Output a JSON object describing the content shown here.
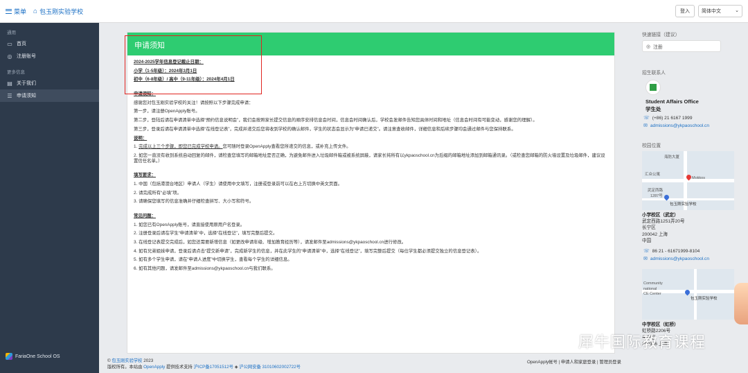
{
  "topbar": {
    "menu_label": "菜单",
    "school_name": "包玉刚实验学校",
    "login_label": "登入",
    "language": "简体中文"
  },
  "sidebar": {
    "section_general": "通用",
    "items_general": [
      {
        "label": "首页",
        "icon": "home-icon"
      },
      {
        "label": "注册账号",
        "icon": "compass-icon"
      }
    ],
    "section_more": "更多信息",
    "items_more": [
      {
        "label": "关于我们",
        "icon": "document-icon"
      },
      {
        "label": "申请须知",
        "icon": "list-icon"
      }
    ],
    "footer_brand": "FariaOne School OS"
  },
  "main": {
    "title": "申请须知",
    "deadline_title": "2024-2025学年信息登记截止日期：",
    "deadline_primary": "小学（1-5年级）：2024年3月1日",
    "deadline_secondary": "初中（6-8年级）/ 高中（9-11年级）：2024年4月1日",
    "notice_heading": "申请须知：",
    "intro": "感谢您对包玉刚实验学校的关注！请按照以下步骤完成申请：",
    "step1": "第一步，请注册OpenApply账号。",
    "step2": "第二步，登陆后请在申请清单中选择“预约信息说明会”，我们会按照家长提交信息的顺序安排信息会时间，信息会时间确认后，学校会发邮件告知您具体时间和地址（信息会时间有可能变动，感谢您的理解）。",
    "step3": "第三步，登录后请在申请清单中选择“在线登记表”，完成并递交后您将收到学校的确认邮件，学生的状态会显示为“申请已递交”。请注意查收邮件，详细信息和后续步骤均会通过邮件与您保持联系。",
    "explain_heading": "说明：",
    "explain1_underlined": "完成以上三个步骤，即您已完成学校申请。",
    "explain1_rest": "您可随时登录OpenApply查看您所递交的信息，或补充上传文件。",
    "explain2": "2. 如您一直没有收到系统自动回复的邮件，请检查您填写的邮箱地址是否正确，为避免邮件进入垃圾邮件箱或被系统屏蔽，请家长将所有以ykpaoschool.cn为后缀的邮箱地址添加到邮箱通讯录。（或检查您邮箱的防火墙设置及垃圾邮件，建议设置信任名单。）",
    "fill_heading": "填写要求：",
    "fill1": "1. 中国（包括港澳台地区）申请人（学生）请使用中文填写，注册或登录前可以在右上方切换中英文页面。",
    "fill2": "2. 请完成所有“必填”项。",
    "fill3": "3. 请确保您填写的信息准确并仔细检查拼写、大小写和符号。",
    "faq_heading": "常见问题：",
    "faq1": "1. 如您已有OpenApply账号，请直接使用原用户名登录。",
    "faq2": "2. 注册登录后请在学生“申请清单”中，选择“在线登记”，填写完整后提交。",
    "faq3": "3. 在线登记表提交完成后，如您还需要新增信息（如更改申请年级、增加教育经历等），请发邮件至admissions@ykpaoschool.cn进行修改。",
    "faq4": "4. 如有兄弟姐妹申请，登录后请点击“提交新申请”，完成新学生的信息，并在此学生的“申请清单”中，选择“在线登记”，填写完整后提交（每位学生都必须提交独立的信息登记表）。",
    "faq5": "5. 如有多个学生申请，请在“申请人进度”中切换学生，查看每个学生的详细信息。",
    "faq6": "6. 如有其他问题，请发邮件至admissions@ykpaoschool.cn与我们联系。"
  },
  "footer": {
    "copyright_prefix": "©",
    "school_link": "包玉刚实验学校",
    "year": "2023",
    "powered_prefix": "版权所有。本站由",
    "openapply_link": "OpenApply",
    "powered_suffix": "提供技术支持",
    "icp": "沪ICP备17051512号",
    "police": "沪公网安备 31010602002722号",
    "right_links": "OpenApply帐号 | 申请人和家庭登录 | 管理员登录"
  },
  "right": {
    "quick_links_label": "快速链接（建议）",
    "register_link": "注册",
    "contact_label": "招生联系人",
    "office_name": "Student Affairs Office",
    "office_name_cn": "学生处",
    "phone": "(+86) 21 6167 1999",
    "email": "admissions@ykpaoschool.cn",
    "location_label": "校园位置",
    "map1_labels": [
      "海防大厦",
      "汇众公寓",
      "Mokkos",
      "武定西路",
      "1287号",
      "包玉刚实验学校"
    ],
    "campus1_name": "小学校区（武定）",
    "campus1_addr1": "武定西路1251弄20号",
    "campus1_addr2": "长宁区",
    "campus1_addr3": "200042 上海",
    "campus1_addr4": "中国",
    "campus1_phone": "86 21 - 61671999-8104",
    "campus1_email": "admissions@ykpaoschool.cn",
    "map2_labels": [
      "Community",
      "national",
      "CE Center",
      "包玉刚实验学校"
    ],
    "campus2_name": "中学校区（虹桥）",
    "campus2_addr1": "虹桥路2206号",
    "campus2_addr2": "长宁区",
    "campus2_addr3": "200336 上海"
  },
  "watermark": {
    "text": "犀牛国际教育课程"
  },
  "colors": {
    "header_green": "#2ecc71",
    "sidebar_bg": "#2d3a4b",
    "link_blue": "#1a6fc4",
    "highlight_red": "#e0241f"
  }
}
